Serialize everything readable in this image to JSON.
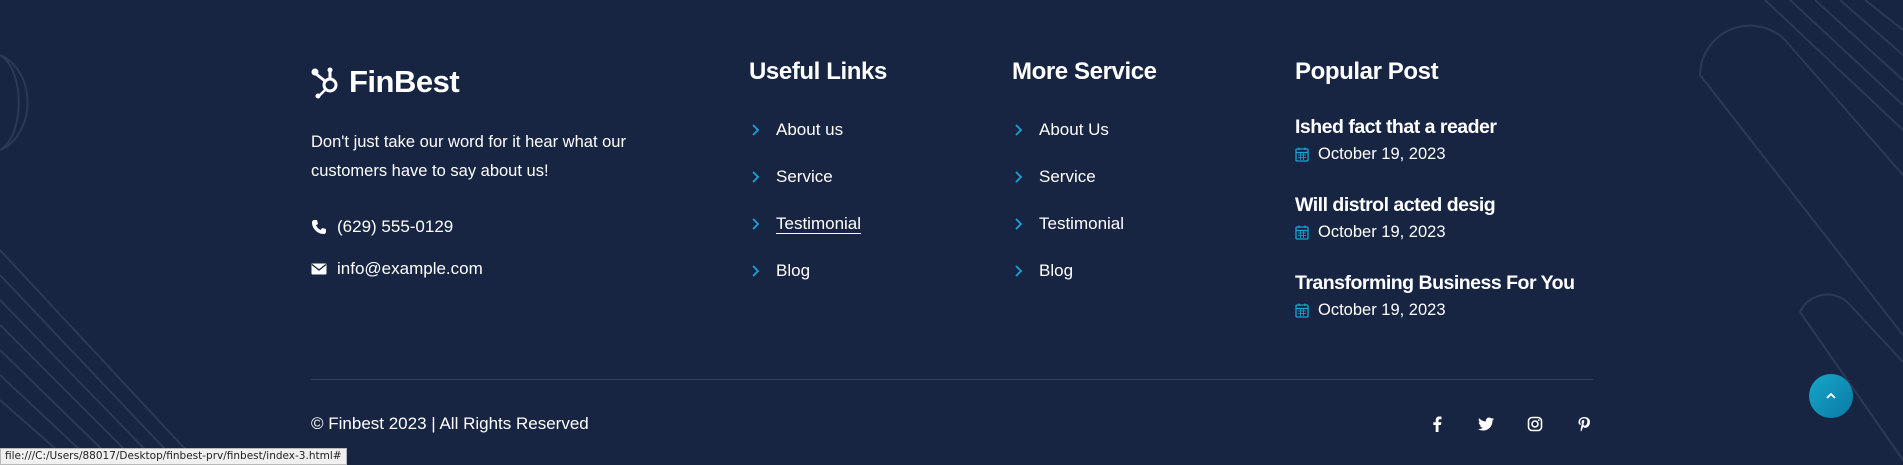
{
  "brand": {
    "name": "FinBest"
  },
  "about": {
    "text": "Don't just take our word for it hear what our customers have to say about us!"
  },
  "contact": {
    "phone": "(629) 555-0129",
    "email": "info@example.com",
    "phone_icon": "phone-icon",
    "email_icon": "envelope-icon"
  },
  "useful_links": {
    "title": "Useful Links",
    "items": [
      "About us",
      "Service",
      "Testimonial",
      "Blog"
    ]
  },
  "more_service": {
    "title": "More Service",
    "items": [
      "About Us",
      "Service",
      "Testimonial",
      "Blog"
    ]
  },
  "popular_post": {
    "title": "Popular Post",
    "posts": [
      {
        "title": "Ished fact that a reader",
        "date": "October 19, 2023"
      },
      {
        "title": "Will distrol acted desig",
        "date": "October 19, 2023"
      },
      {
        "title": "Transforming Business For You",
        "date": "October 19, 2023"
      }
    ]
  },
  "footer": {
    "copyright": "© Finbest 2023 | All Rights Reserved",
    "socials": [
      "facebook-icon",
      "twitter-icon",
      "instagram-icon",
      "pinterest-icon"
    ]
  },
  "status_bar": {
    "url": "file:///C:/Users/88017/Desktop/finbest-prv/finbest/index-3.html#"
  },
  "colors": {
    "background": "#172542",
    "accent": "#1aa3d4",
    "text": "#ffffff"
  }
}
